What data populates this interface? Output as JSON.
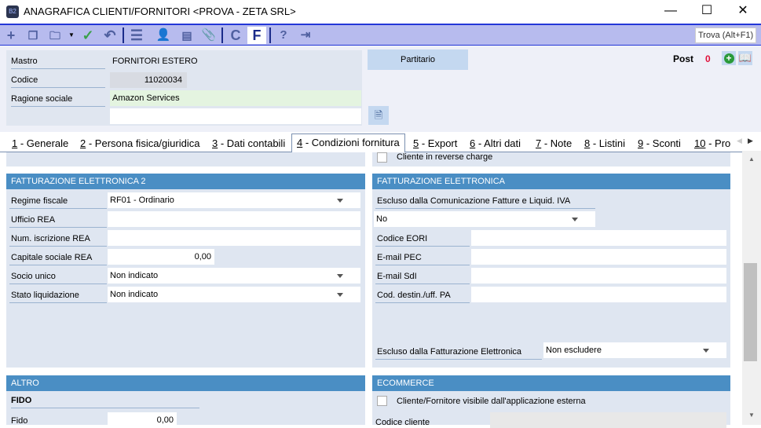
{
  "window": {
    "title": "ANAGRAFICA CLIENTI/FORNITORI <PROVA - ZETA SRL>",
    "app_icon": "B2",
    "minimize": "—",
    "maximize": "☐",
    "close": "✕"
  },
  "toolbar": {
    "find_label": "Trova (Alt+F1)",
    "c_label": "C",
    "f_label": "F"
  },
  "header": {
    "mastro_label": "Mastro",
    "mastro_value": "FORNITORI ESTERO",
    "codice_label": "Codice",
    "codice_value": "11020034",
    "ragione_label": "Ragione sociale",
    "ragione_value": "Amazon Services",
    "partitario_label": "Partitario",
    "post_label": "Post",
    "post_count": "0"
  },
  "tabs": [
    {
      "num": "1",
      "label": " - Generale"
    },
    {
      "num": "2",
      "label": " - Persona fisica/giuridica"
    },
    {
      "num": "3",
      "label": " - Dati contabili"
    },
    {
      "num": "4",
      "label": " - Condizioni fornitura"
    },
    {
      "num": "5",
      "label": " - Export"
    },
    {
      "num": "6",
      "label": " - Altri dati"
    },
    {
      "num": "7",
      "label": " - Note"
    },
    {
      "num": "8",
      "label": " - Listini"
    },
    {
      "num": "9",
      "label": " - Sconti"
    },
    {
      "num": "10",
      "label": " - Pro"
    }
  ],
  "reverse_charge_label": "Cliente in reverse charge",
  "fe2": {
    "title": "FATTURAZIONE ELETTRONICA 2",
    "regime_label": "Regime fiscale",
    "regime_value": "RF01 - Ordinario",
    "ufficio_label": "Ufficio REA",
    "ufficio_value": "",
    "num_label": "Num. iscrizione REA",
    "num_value": "",
    "capitale_label": "Capitale sociale REA",
    "capitale_value": "0,00",
    "socio_label": "Socio unico",
    "socio_value": "Non indicato",
    "stato_label": "Stato liquidazione",
    "stato_value": "Non indicato"
  },
  "fe": {
    "title": "FATTURAZIONE ELETTRONICA",
    "escluso_com_label": "Escluso dalla Comunicazione Fatture e Liquid. IVA",
    "escluso_com_value": "No",
    "eori_label": "Codice EORI",
    "pec_label": "E-mail PEC",
    "sdi_label": "E-mail SdI",
    "dest_label": "Cod. destin./uff. PA",
    "escluso_fe_label": "Escluso dalla Fatturazione Elettronica",
    "escluso_fe_value": "Non escludere"
  },
  "altro": {
    "title": "ALTRO",
    "fido_heading": "FIDO",
    "fido_label": "Fido",
    "fido_value": "0,00"
  },
  "ecommerce": {
    "title": "ECOMMERCE",
    "visibile_label": "Cliente/Fornitore visibile dall'applicazione esterna",
    "codice_label": "Codice cliente"
  }
}
